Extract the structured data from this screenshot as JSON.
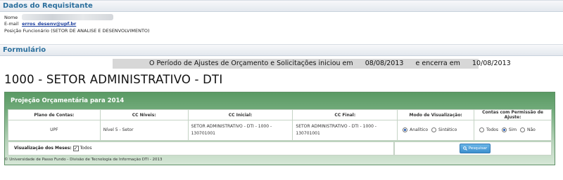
{
  "requester": {
    "section_title": "Dados do Requisitante",
    "name_label": "Nome",
    "email_label": "E-mail",
    "email_value": "erros_desenv@upf.br",
    "position_label": "Posição Funcionário",
    "position_value": "(SETOR DE ANALISE E DESENVOLVIMENTO)"
  },
  "form": {
    "section_title": "Formulário",
    "period": {
      "prefix": "O Período de Ajustes de Orçamento e Solicitações iniciou em",
      "start_date": "08/08/2013",
      "middle": "e encerra em",
      "end_date": "10/08/2013"
    },
    "sector_title": "1000 - SETOR ADMINISTRATIVO - DTI",
    "panel_title": "Projeção Orçamentária para 2014",
    "columns": [
      "Plano de Contas:",
      "CC Níveis:",
      "CC Inicial:",
      "CC Final:",
      "Modo de Visualização:",
      "Contas com Permissão de Ajuste:"
    ],
    "row": {
      "plano": "UPF",
      "niveis": "Nível 5 - Setor",
      "cc_inicial": "SETOR ADMINISTRATIVO - DTI - 1000 - 130701001",
      "cc_final": "SETOR ADMINISTRATIVO - DTI - 1000 - 130701001"
    },
    "view_mode": {
      "option1": "Analítico",
      "option2": "Sintético",
      "selected": "Analítico"
    },
    "permission": {
      "option1": "Todos",
      "option2": "Sim",
      "option3": "Não",
      "selected": "Sim"
    },
    "months_label": "Visualização dos Meses:",
    "months_checkbox_label": "Todos",
    "months_checked": true,
    "search_button": "Pesquisar"
  },
  "footer": "© Universidade de Passo Fundo - Divisão de Tecnologia de Informação DTI - 2013",
  "colors": {
    "header_text": "#2b6f9d",
    "panel_green": "#5a9a64",
    "button_blue": "#3c8fcd"
  }
}
